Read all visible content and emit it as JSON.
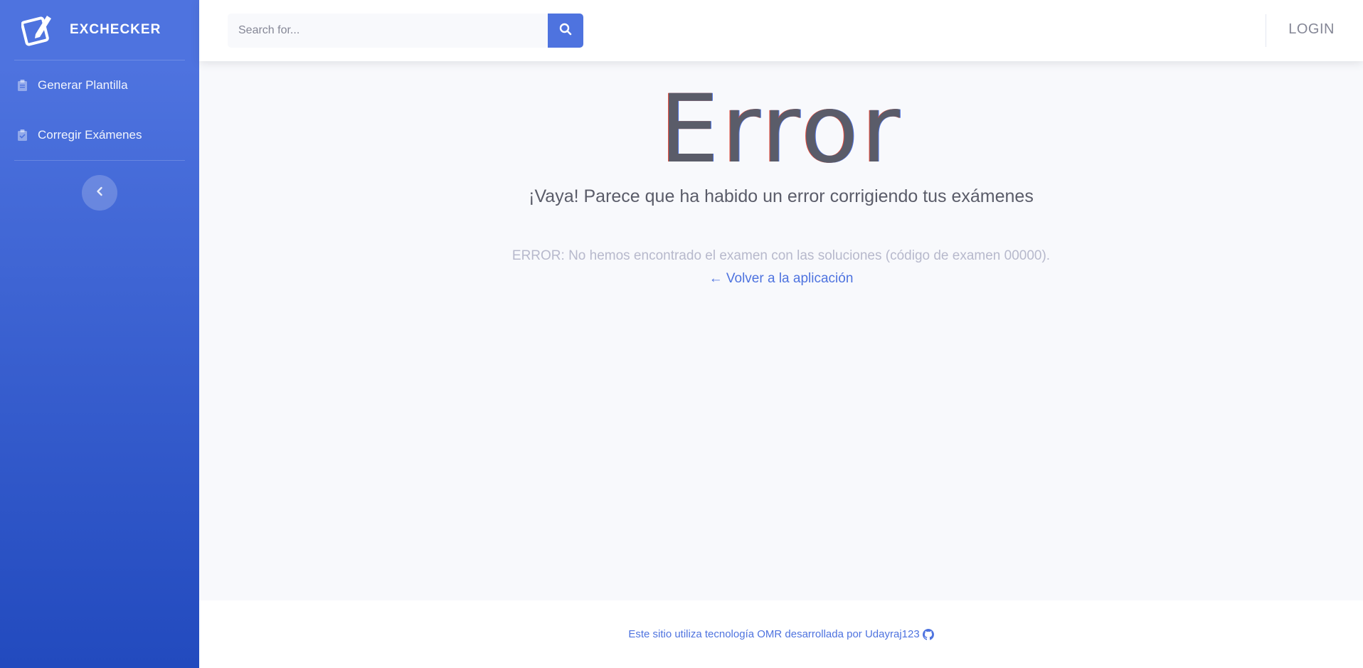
{
  "sidebar": {
    "brand": "EXCHECKER",
    "items": [
      {
        "label": "Generar Plantilla",
        "icon": "clipboard-icon"
      },
      {
        "label": "Corregir Exámenes",
        "icon": "clipboard-check-icon"
      }
    ],
    "toggle_icon": "chevron-left-icon"
  },
  "topbar": {
    "search_placeholder": "Search for...",
    "search_icon": "search-icon",
    "login_label": "LOGIN"
  },
  "main": {
    "error_title": "Error",
    "subtitle": "¡Vaya! Parece que ha habido un error corrigiendo tus exámenes",
    "error_message": "ERROR: No hemos encontrado el examen con las soluciones (código de examen 00000).",
    "back_link": "← Volver a la aplicación"
  },
  "footer": {
    "text": "Este sitio utiliza tecnología OMR desarrollada por Udayraj123",
    "icon": "github-icon"
  },
  "colors": {
    "primary": "#4e73df",
    "primary_dark": "#224abe",
    "background": "#f8f9fc",
    "text_dark": "#5a5c69",
    "text_muted": "#b7b9cc"
  }
}
